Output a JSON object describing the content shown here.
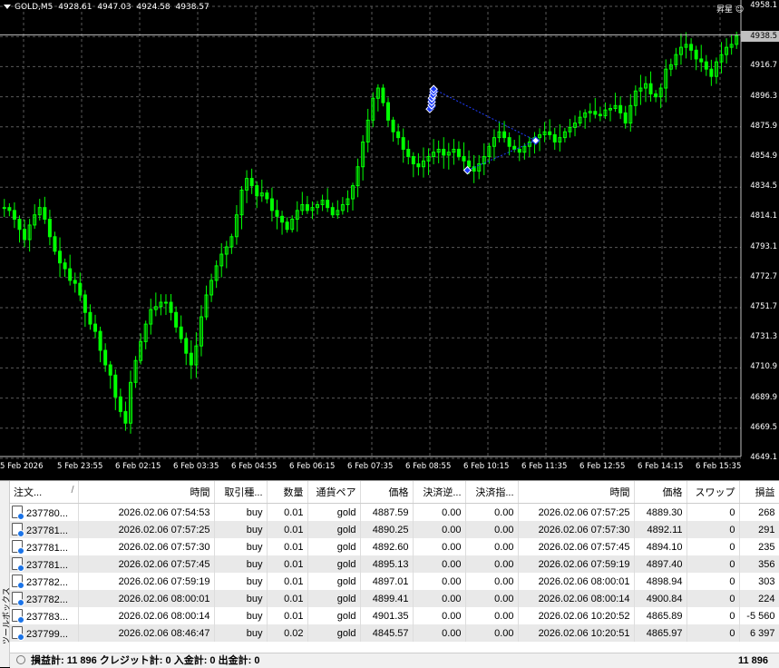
{
  "chart": {
    "symbol": "GOLD,M5",
    "ohlc": [
      "4928.61",
      "4947.03",
      "4924.58",
      "4938.57"
    ],
    "corner_text": "昇星",
    "current_price": "4938.5",
    "price_axis": [
      "4958.1",
      "4916.7",
      "4896.3",
      "4875.9",
      "4854.9",
      "4834.5",
      "4814.1",
      "4793.1",
      "4772.7",
      "4751.7",
      "4731.3",
      "4710.9",
      "4689.9",
      "4669.5",
      "4649.1"
    ],
    "time_axis": [
      "5 Feb 2026",
      "5 Feb 23:55",
      "6 Feb 02:15",
      "6 Feb 03:35",
      "6 Feb 04:55",
      "6 Feb 06:15",
      "6 Feb 07:35",
      "6 Feb 08:55",
      "6 Feb 10:15",
      "6 Feb 11:35",
      "6 Feb 12:55",
      "6 Feb 14:15",
      "6 Feb 15:35"
    ],
    "colors": {
      "background": "#000000",
      "grid": "#5a5a5a",
      "candle": "#00ff00",
      "trade_marker": "#1e3cff",
      "bid_line": "#c0c0c0"
    },
    "chart_data": {
      "type": "line",
      "title": "GOLD,M5",
      "xlabel": "",
      "ylabel": "",
      "ylim": [
        4649.1,
        4958.1
      ],
      "grid": true,
      "series": [
        {
          "values": [
            4820,
            4818,
            4812,
            4805,
            4798,
            4808,
            4815,
            4820,
            4812,
            4800,
            4790,
            4782,
            4778,
            4770,
            4768,
            4760,
            4748,
            4740,
            4735,
            4722,
            4712,
            4705,
            4690,
            4680,
            4672,
            4700,
            4715,
            4728,
            4740,
            4750,
            4752,
            4755,
            4755,
            4748,
            4738,
            4730,
            4720,
            4712,
            4725,
            4745,
            4760,
            4770,
            4780,
            4788,
            4793,
            4800,
            4815,
            4832,
            4840,
            4835,
            4828,
            4830,
            4826,
            4818,
            4814,
            4810,
            4805,
            4812,
            4818,
            4822,
            4818,
            4820,
            4822,
            4825,
            4820,
            4815,
            4818,
            4822,
            4826,
            4835,
            4848,
            4865,
            4880,
            4895,
            4902,
            4892,
            4880,
            4872,
            4868,
            4860,
            4855,
            4850,
            4848,
            4852,
            4855,
            4858,
            4860,
            4856,
            4858,
            4860,
            4855,
            4852,
            4848,
            4845,
            4850,
            4855,
            4862,
            4868,
            4872,
            4868,
            4862,
            4860,
            4858,
            4862,
            4865,
            4868,
            4870,
            4872,
            4870,
            4865,
            4868,
            4872,
            4875,
            4878,
            4882,
            4885,
            4886,
            4884,
            4883,
            4887,
            4888,
            4890,
            4885,
            4878,
            4890,
            4900,
            4902,
            4905,
            4898,
            4896,
            4902,
            4915,
            4918,
            4925,
            4930,
            4932,
            4928,
            4922,
            4920,
            4915,
            4910,
            4920,
            4925,
            4930,
            4932,
            4938
          ]
        }
      ],
      "trades": [
        {
          "open_time": "2026.02.06 07:54:53",
          "type": "buy",
          "volume": "0.01",
          "open_price": 4887.59,
          "close_time": "2026.02.06 07:57:25",
          "close_price": 4889.3
        },
        {
          "open_time": "2026.02.06 07:57:25",
          "type": "buy",
          "volume": "0.01",
          "open_price": 4890.25,
          "close_time": "2026.02.06 07:57:30",
          "close_price": 4892.11
        },
        {
          "open_time": "2026.02.06 07:57:30",
          "type": "buy",
          "volume": "0.01",
          "open_price": 4892.6,
          "close_time": "2026.02.06 07:57:45",
          "close_price": 4894.1
        },
        {
          "open_time": "2026.02.06 07:57:45",
          "type": "buy",
          "volume": "0.01",
          "open_price": 4895.13,
          "close_time": "2026.02.06 07:59:19",
          "close_price": 4897.4
        },
        {
          "open_time": "2026.02.06 07:59:19",
          "type": "buy",
          "volume": "0.01",
          "open_price": 4897.01,
          "close_time": "2026.02.06 08:00:01",
          "close_price": 4898.94
        },
        {
          "open_time": "2026.02.06 08:00:01",
          "type": "buy",
          "volume": "0.01",
          "open_price": 4899.41,
          "close_time": "2026.02.06 08:00:14",
          "close_price": 4900.84
        },
        {
          "open_time": "2026.02.06 08:00:14",
          "type": "buy",
          "volume": "0.01",
          "open_price": 4901.35,
          "close_time": "2026.02.06 10:20:52",
          "close_price": 4865.89
        },
        {
          "open_time": "2026.02.06 08:46:47",
          "type": "buy",
          "volume": "0.02",
          "open_price": 4845.57,
          "close_time": "2026.02.06 10:20:51",
          "close_price": 4865.97
        }
      ]
    }
  },
  "terminal": {
    "side_label": "ツールボックス",
    "columns": [
      "注文...",
      "時間",
      "取引種...",
      "数量",
      "通貨ペア",
      "価格",
      "決済逆...",
      "決済指...",
      "時間",
      "価格",
      "スワップ",
      "損益"
    ],
    "rows": [
      [
        "237780...",
        "2026.02.06 07:54:53",
        "buy",
        "0.01",
        "gold",
        "4887.59",
        "0.00",
        "0.00",
        "2026.02.06 07:57:25",
        "4889.30",
        "0",
        "268"
      ],
      [
        "237781...",
        "2026.02.06 07:57:25",
        "buy",
        "0.01",
        "gold",
        "4890.25",
        "0.00",
        "0.00",
        "2026.02.06 07:57:30",
        "4892.11",
        "0",
        "291"
      ],
      [
        "237781...",
        "2026.02.06 07:57:30",
        "buy",
        "0.01",
        "gold",
        "4892.60",
        "0.00",
        "0.00",
        "2026.02.06 07:57:45",
        "4894.10",
        "0",
        "235"
      ],
      [
        "237781...",
        "2026.02.06 07:57:45",
        "buy",
        "0.01",
        "gold",
        "4895.13",
        "0.00",
        "0.00",
        "2026.02.06 07:59:19",
        "4897.40",
        "0",
        "356"
      ],
      [
        "237782...",
        "2026.02.06 07:59:19",
        "buy",
        "0.01",
        "gold",
        "4897.01",
        "0.00",
        "0.00",
        "2026.02.06 08:00:01",
        "4898.94",
        "0",
        "303"
      ],
      [
        "237782...",
        "2026.02.06 08:00:01",
        "buy",
        "0.01",
        "gold",
        "4899.41",
        "0.00",
        "0.00",
        "2026.02.06 08:00:14",
        "4900.84",
        "0",
        "224"
      ],
      [
        "237783...",
        "2026.02.06 08:00:14",
        "buy",
        "0.01",
        "gold",
        "4901.35",
        "0.00",
        "0.00",
        "2026.02.06 10:20:52",
        "4865.89",
        "0",
        "-5 560"
      ],
      [
        "237799...",
        "2026.02.06 08:46:47",
        "buy",
        "0.02",
        "gold",
        "4845.57",
        "0.00",
        "0.00",
        "2026.02.06 10:20:51",
        "4865.97",
        "0",
        "6 397"
      ]
    ],
    "summary": {
      "text": "損益計: 11 896  クレジット計: 0  入金計: 0  出金計: 0",
      "total": "11 896"
    }
  }
}
